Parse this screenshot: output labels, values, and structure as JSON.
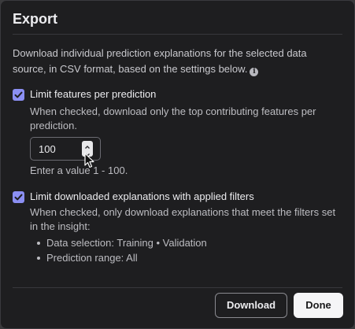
{
  "dialog": {
    "title": "Export",
    "description": "Download individual prediction explanations for the selected data source, in CSV format, based on the settings below.",
    "info_icon": "info-icon"
  },
  "option_limit_features": {
    "checked": true,
    "label": "Limit features per prediction",
    "help": "When checked, download only the top contributing features per prediction.",
    "input_value": "100",
    "range_hint": "Enter a value 1 - 100."
  },
  "option_limit_filters": {
    "checked": true,
    "label": "Limit downloaded explanations with applied filters",
    "help": "When checked, only download explanations that meet the filters set in the insight:",
    "filters": [
      "Data selection: Training • Validation",
      "Prediction range: All"
    ]
  },
  "footer": {
    "download_label": "Download",
    "done_label": "Done"
  },
  "colors": {
    "background": "#1e1e20",
    "checkbox_accent": "#8b8ff3",
    "primary_button": "#f5f5f7"
  }
}
